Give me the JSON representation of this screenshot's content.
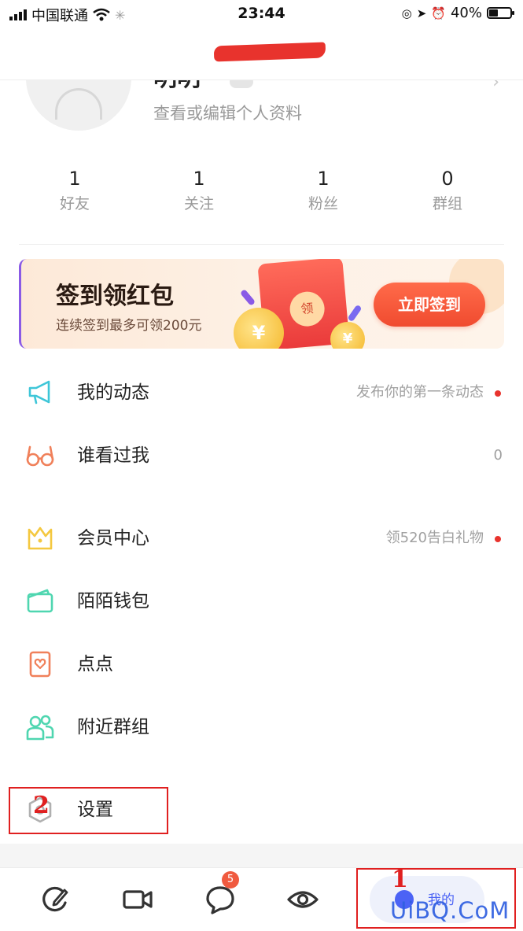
{
  "status_bar": {
    "carrier": "中国联通",
    "time": "23:44",
    "battery": "40%"
  },
  "profile": {
    "name": "明明",
    "edit_link": "查看或编辑个人资料"
  },
  "stats": [
    {
      "value": "1",
      "label": "好友"
    },
    {
      "value": "1",
      "label": "关注"
    },
    {
      "value": "1",
      "label": "粉丝"
    },
    {
      "value": "0",
      "label": "群组"
    }
  ],
  "banner": {
    "title": "签到领红包",
    "subtitle": "连续签到最多可领200元",
    "envelope_text": "领",
    "coin_symbol": "¥",
    "button_label": "立即签到"
  },
  "menu": [
    {
      "icon": "megaphone-icon",
      "label": "我的动态",
      "value": "发布你的第一条动态",
      "dot": true
    },
    {
      "icon": "glasses-icon",
      "label": "谁看过我",
      "value": "0",
      "dot": false
    },
    {
      "icon": "crown-icon",
      "label": "会员中心",
      "value": "领520告白礼物",
      "dot": true
    },
    {
      "icon": "wallet-icon",
      "label": "陌陌钱包",
      "value": "",
      "dot": false
    },
    {
      "icon": "heart-card-icon",
      "label": "点点",
      "value": "",
      "dot": false
    },
    {
      "icon": "group-icon",
      "label": "附近群组",
      "value": "",
      "dot": false
    },
    {
      "icon": "hexagon-gear-icon",
      "label": "设置",
      "value": "",
      "dot": false
    }
  ],
  "annotations": {
    "settings_marker": "2",
    "mine_tab_marker": "1"
  },
  "tab_bar": {
    "messages_badge": "5",
    "mine_label": "我的"
  },
  "watermark": "UiBQ.CoM",
  "colors": {
    "accent_red": "#e8332d",
    "tab_blue": "#4b63f5",
    "banner_button": "#f04b2f",
    "annotation_red": "#e02020"
  }
}
